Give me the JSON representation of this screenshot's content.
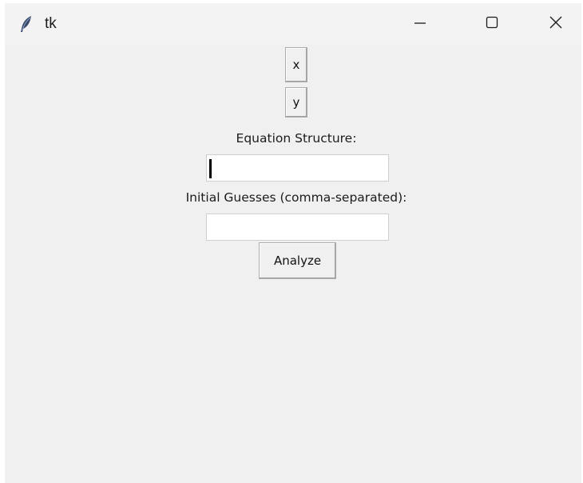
{
  "window": {
    "title": "tk",
    "icon": "feather-icon",
    "controls": {
      "minimize": "minimize-icon",
      "maximize": "maximize-icon",
      "close": "close-icon"
    }
  },
  "buttons": {
    "x_label": "x",
    "y_label": "y",
    "analyze_label": "Analyze"
  },
  "form": {
    "equation_label": "Equation Structure:",
    "equation_value": "",
    "guesses_label": "Initial Guesses (comma-separated):",
    "guesses_value": ""
  },
  "colors": {
    "background": "#f0f0f0",
    "titlebar": "#f3f3f3",
    "entry_background": "#ffffff"
  }
}
